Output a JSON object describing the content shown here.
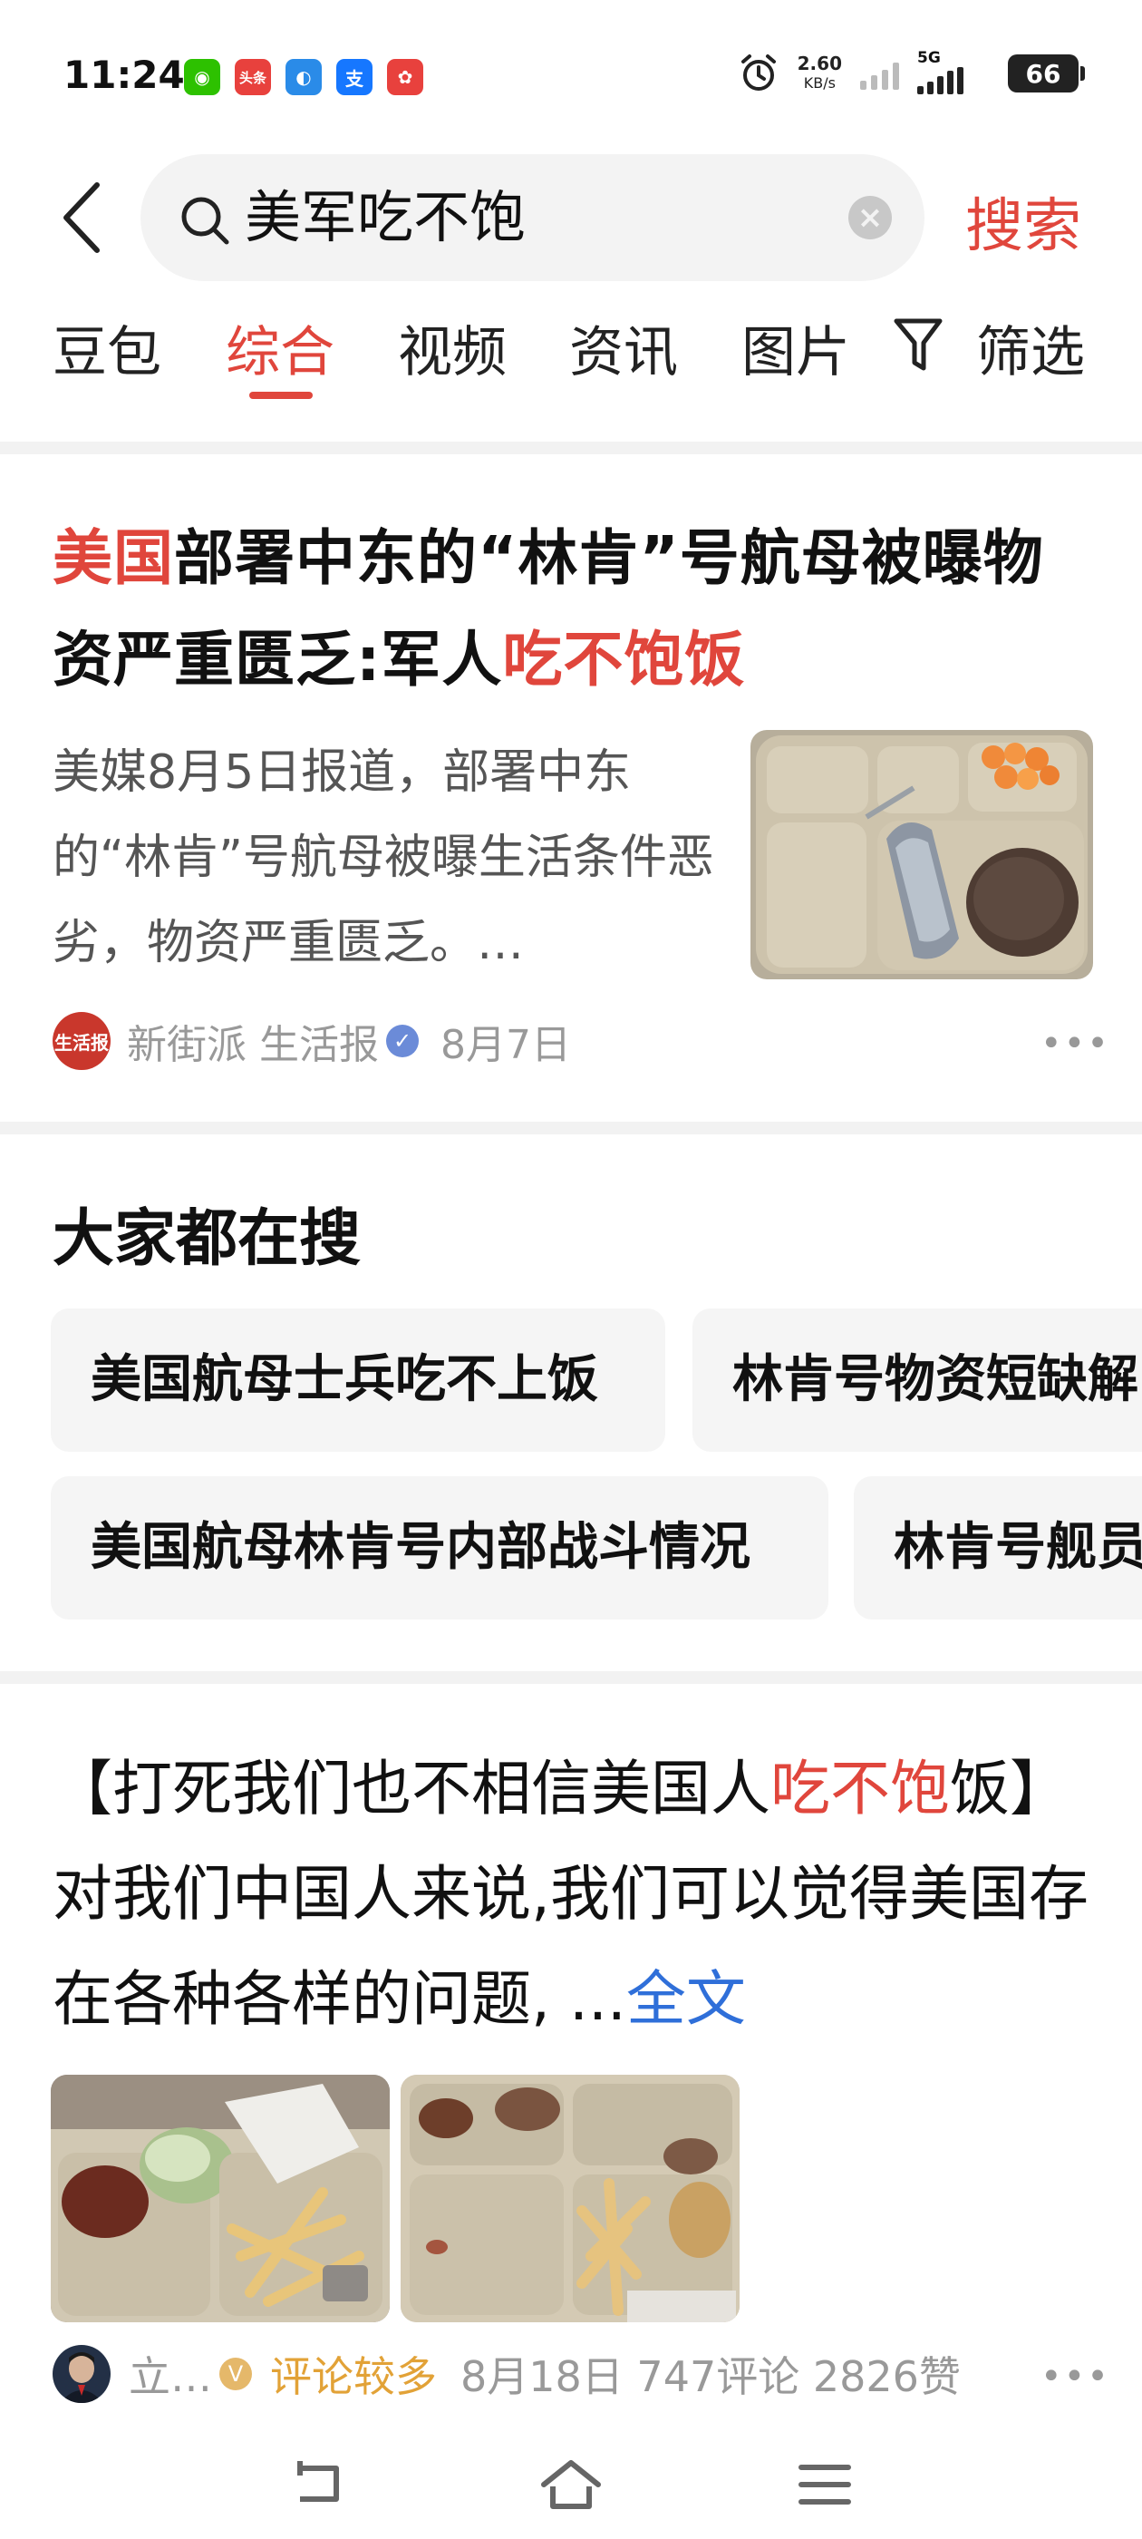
{
  "status_bar": {
    "time": "11:24",
    "apps": [
      {
        "name": "wechat-icon",
        "glyph": "◉",
        "color": "#2dc100"
      },
      {
        "name": "toutiao-icon",
        "glyph": "头条",
        "color": "#e8413d"
      },
      {
        "name": "cloud-icon",
        "glyph": "◐",
        "color": "#2a8be8"
      },
      {
        "name": "alipay-icon",
        "glyph": "支",
        "color": "#1677ff"
      },
      {
        "name": "gift-icon",
        "glyph": "✿",
        "color": "#e8413d"
      }
    ],
    "net_speed": "2.60",
    "net_unit": "KB/s",
    "network": "5G",
    "battery": "66"
  },
  "search": {
    "query": "美军吃不饱",
    "button_label": "搜索"
  },
  "tabs": [
    {
      "label": "豆包"
    },
    {
      "label": "综合",
      "active": true
    },
    {
      "label": "视频"
    },
    {
      "label": "资讯"
    },
    {
      "label": "图片"
    },
    {
      "label": "筛选"
    }
  ],
  "card1": {
    "title_hl1": "美国",
    "title_mid": "部署中东的“林肯”号航母被曝物资严重匮乏:军人",
    "title_hl2": "吃不饱饭",
    "summary": "美媒8月5日报道，部署中东的“林肯”号航母被曝生活条件恶劣，物资严重匮乏。…",
    "source": "新街派 生活报",
    "date": "8月7日",
    "avatar_text": "生活报"
  },
  "hot": {
    "title": "大家都在搜",
    "chips": [
      "美国航母士兵吃不上饭",
      "林肯号物资短缺解",
      "美国航母林肯号内部战斗情况",
      "林肯号舰员"
    ]
  },
  "card2": {
    "text_a": "【打死我们也不相信美国人",
    "text_hl": "吃不饱",
    "text_b": "饭】 对我们中国人来说,我们可以觉得美国存在各种各样的问题, ...",
    "link": "全文",
    "author": "立…",
    "tag": "评论较多",
    "meta": "8月18日  747评论  2826赞"
  },
  "colors": {
    "accent": "#e0463c",
    "link": "#2f6fd9",
    "tag": "#e2a237"
  }
}
